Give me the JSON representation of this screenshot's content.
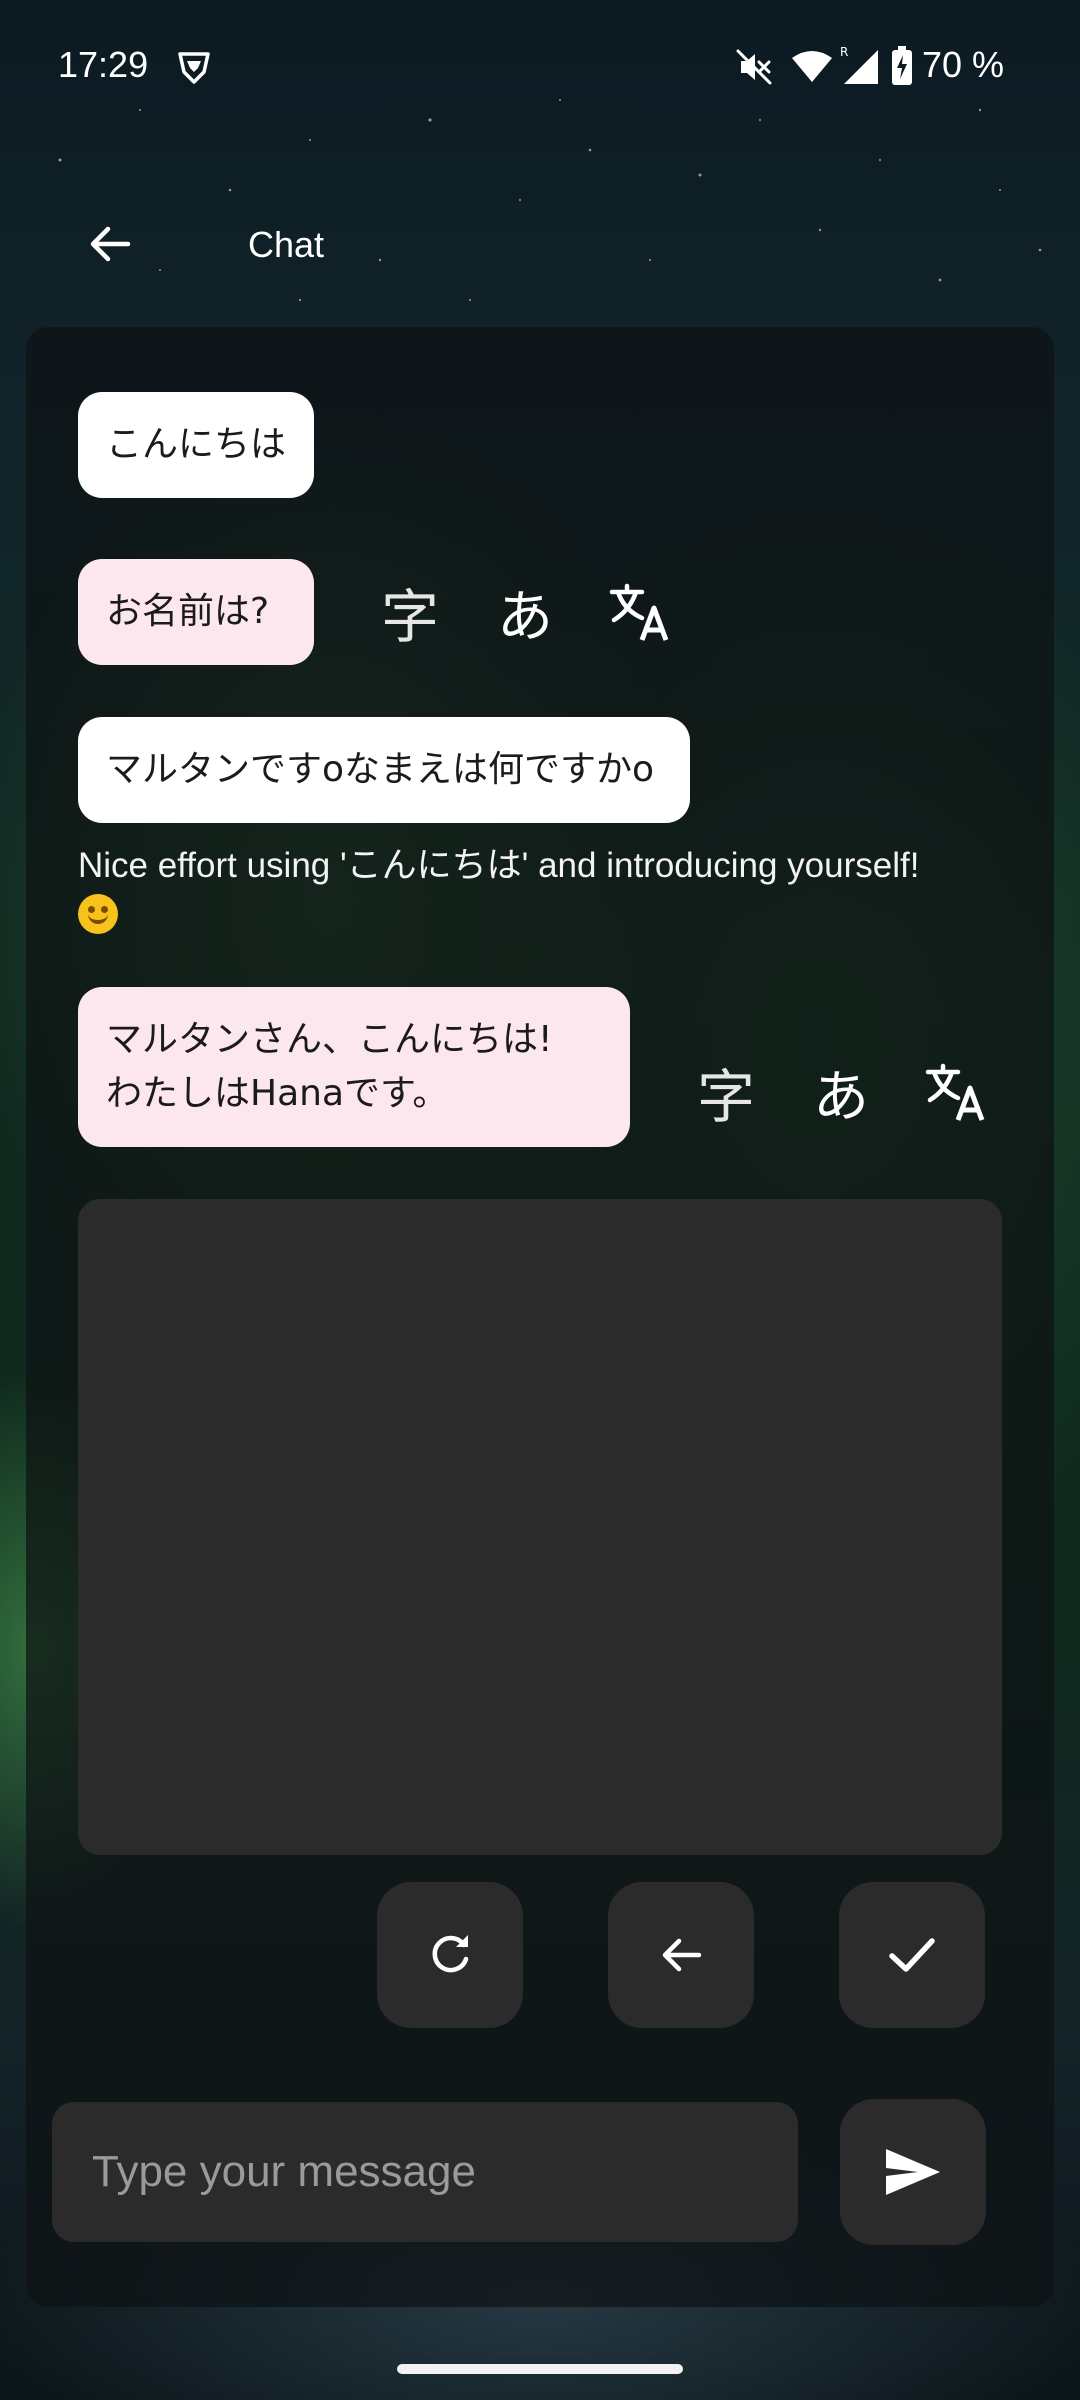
{
  "status_bar": {
    "time": "17:29",
    "battery_text": "70 %",
    "icons": [
      "vpn-shield-icon",
      "mute-icon",
      "wifi-icon",
      "signal-roaming-icon",
      "battery-charging-icon"
    ]
  },
  "app_bar": {
    "title": "Chat",
    "back_icon": "arrow-back-icon"
  },
  "messages": [
    {
      "role": "user",
      "text": "こんにちは"
    },
    {
      "role": "assistant",
      "text": "お名前は?",
      "tools": [
        "字",
        "あ",
        "translate-icon"
      ]
    },
    {
      "role": "user",
      "text": "マルタンですoなまえは何ですかo"
    },
    {
      "role": "feedback",
      "text": "Nice effort using 'こんにちは' and introducing yourself!",
      "emoji": "smiling-face-emoji"
    },
    {
      "role": "assistant",
      "text_line1": "マルタンさん、こんにちは!",
      "text_line2": "わたしはHanaです。",
      "tools": [
        "字",
        "あ",
        "translate-icon"
      ]
    }
  ],
  "handwriting": {
    "actions": [
      "refresh-icon",
      "backspace-arrow-icon",
      "check-icon"
    ]
  },
  "composer": {
    "placeholder": "Type your message",
    "value": "",
    "send_icon": "send-icon"
  },
  "colors": {
    "user_bubble": "#ffffff",
    "assistant_bubble": "#fde7ef",
    "panel": "#2b2b2b"
  }
}
